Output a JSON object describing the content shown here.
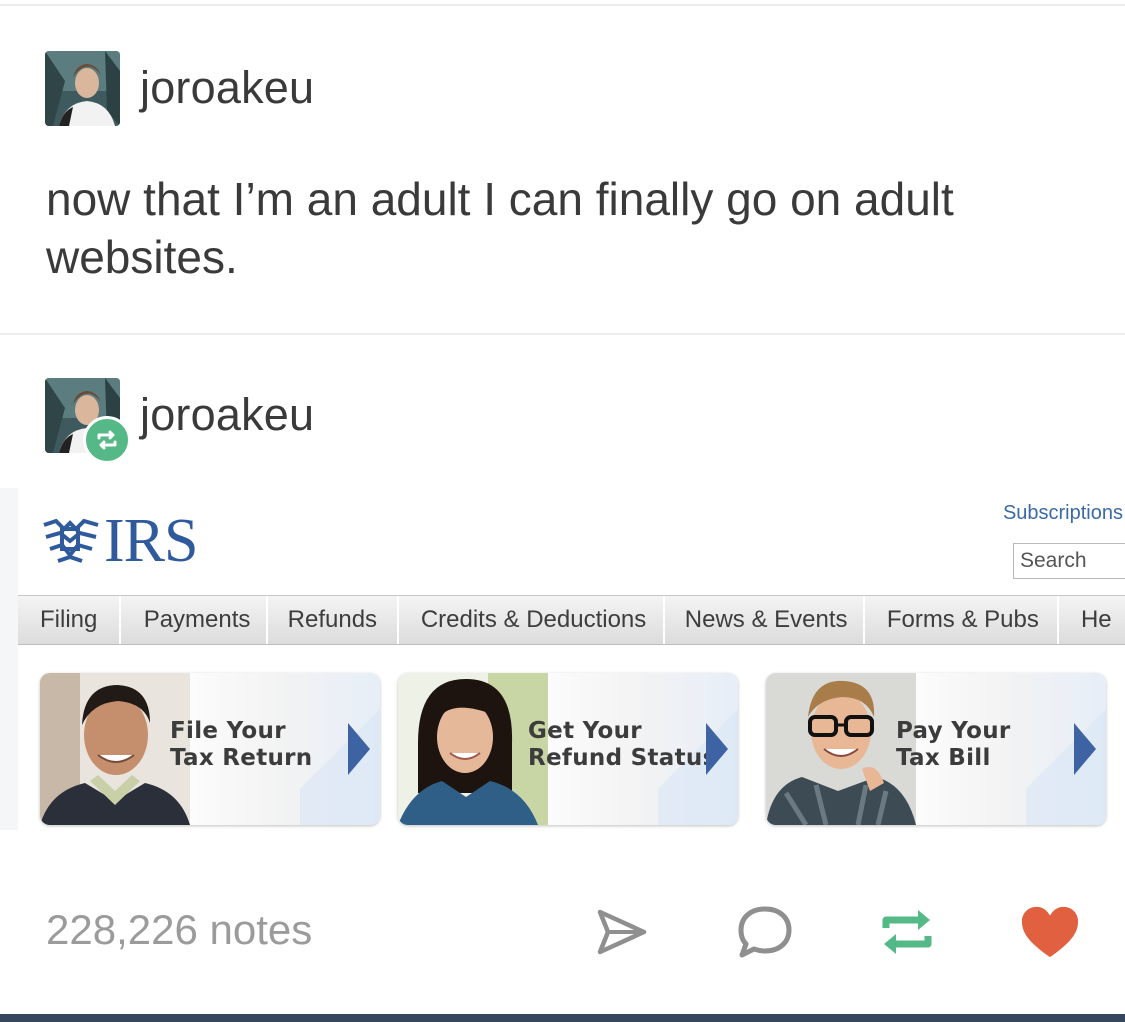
{
  "post": {
    "username": "joroakeu",
    "text": "now that I’m an adult I can finally go on adult websites."
  },
  "reblog": {
    "username": "joroakeu"
  },
  "irs_screenshot": {
    "logo_text": "IRS",
    "subscriptions_link": "Subscriptions",
    "search_placeholder": "Search",
    "nav": [
      "Filing",
      "Payments",
      "Refunds",
      "Credits & Deductions",
      "News & Events",
      "Forms & Pubs",
      "He"
    ],
    "cards": [
      {
        "line1": "File Your",
        "line2": "Tax Return"
      },
      {
        "line1": "Get Your",
        "line2": "Refund Status"
      },
      {
        "line1": "Pay Your",
        "line2": "Tax Bill"
      }
    ],
    "brand_color": "#2f5b9c"
  },
  "footer": {
    "notes": "228,226 notes",
    "icons": [
      "share-icon",
      "reply-icon",
      "reblog-icon",
      "like-icon"
    ],
    "reblog_color": "#55b887",
    "like_color": "#e0603f"
  }
}
